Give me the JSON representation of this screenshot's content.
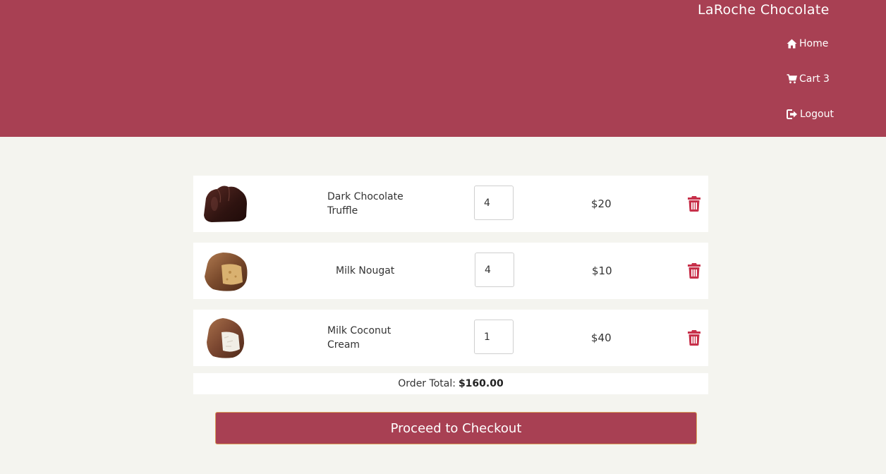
{
  "header": {
    "brand": "LaRoche Chocolate",
    "background": "#a84053",
    "nav": [
      {
        "label": "Home",
        "icon": "home-icon"
      },
      {
        "label": "Cart 3",
        "icon": "cart-icon"
      },
      {
        "label": "Logout",
        "icon": "logout-icon"
      }
    ]
  },
  "cart": {
    "items": [
      {
        "name": "Dark Chocolate Truffle",
        "quantity": "4",
        "price": "$20",
        "image": "dark-chocolate-truffle-image"
      },
      {
        "name": "Milk Nougat",
        "quantity": "4",
        "price": "$10",
        "image": "milk-nougat-image"
      },
      {
        "name": "Milk Coconut Cream",
        "quantity": "1",
        "price": "$40",
        "image": "milk-coconut-cream-image"
      }
    ],
    "total_label": "Order Total:",
    "total_value": "$160.00",
    "delete_icon": "trash-icon",
    "delete_color": "#c7304a"
  },
  "checkout": {
    "label": "Proceed to Checkout"
  }
}
